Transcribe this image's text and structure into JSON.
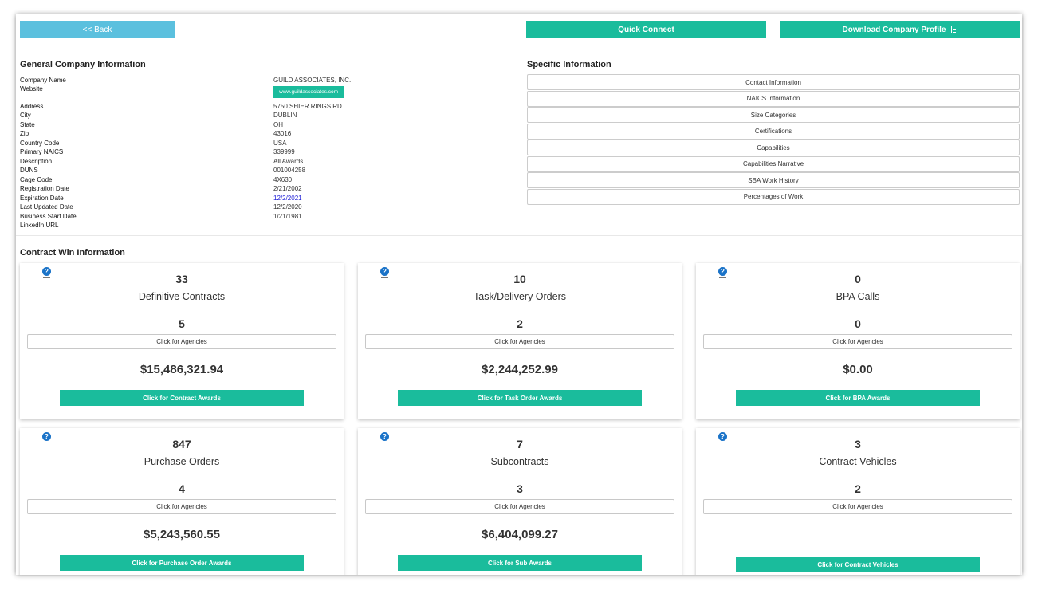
{
  "toolbar": {
    "back_label": "<< Back",
    "quick_connect_label": "Quick Connect",
    "download_label": "Download Company Profile"
  },
  "general": {
    "title": "General Company Information",
    "rows": [
      {
        "label": "Company Name",
        "value": "GUILD ASSOCIATES, INC."
      },
      {
        "label": "Website",
        "value": "www.guildassociates.com"
      },
      {
        "label": "Address",
        "value": "5750 SHIER RINGS RD"
      },
      {
        "label": "City",
        "value": "DUBLIN"
      },
      {
        "label": "State",
        "value": "OH"
      },
      {
        "label": "Zip",
        "value": "43016"
      },
      {
        "label": "Country Code",
        "value": "USA"
      },
      {
        "label": "Primary NAICS",
        "value": "339999"
      },
      {
        "label": "Description",
        "value": "All Awards"
      },
      {
        "label": "DUNS",
        "value": "001004258"
      },
      {
        "label": "Cage Code",
        "value": "4X630"
      },
      {
        "label": "Registration Date",
        "value": "2/21/2002"
      },
      {
        "label": "Expiration Date",
        "value": "12/2/2021"
      },
      {
        "label": "Last Updated Date",
        "value": "12/2/2020"
      },
      {
        "label": "Business Start Date",
        "value": "1/21/1981"
      },
      {
        "label": "LinkedIn URL",
        "value": ""
      }
    ]
  },
  "specific": {
    "title": "Specific Information",
    "items": [
      "Contact Information",
      "NAICS Information",
      "Size Categories",
      "Certifications",
      "Capabilities",
      "Capabilities Narrative",
      "SBA Work History",
      "Percentages of Work"
    ]
  },
  "contracts": {
    "title": "Contract Win Information",
    "agency_label": "Click for Agencies",
    "cards": [
      {
        "count": "33",
        "label": "Definitive Contracts",
        "agencies": "5",
        "amount": "$15,486,321.94",
        "button": "Click for Contract Awards"
      },
      {
        "count": "10",
        "label": "Task/Delivery Orders",
        "agencies": "2",
        "amount": "$2,244,252.99",
        "button": "Click for Task Order Awards"
      },
      {
        "count": "0",
        "label": "BPA Calls",
        "agencies": "0",
        "amount": "$0.00",
        "button": "Click for BPA Awards"
      },
      {
        "count": "847",
        "label": "Purchase Orders",
        "agencies": "4",
        "amount": "$5,243,560.55",
        "button": "Click for Purchase Order Awards"
      },
      {
        "count": "7",
        "label": "Subcontracts",
        "agencies": "3",
        "amount": "$6,404,099.27",
        "button": "Click for Sub Awards"
      },
      {
        "count": "3",
        "label": "Contract Vehicles",
        "agencies": "2",
        "amount": "",
        "button": "Click for Contract Vehicles"
      }
    ]
  },
  "colors": {
    "primary": "#1abc9c",
    "info": "#5bc0de",
    "help": "#1a73c8",
    "link": "#1a1ad6"
  },
  "icons": {
    "download": "document-icon",
    "help": "question-circle-icon"
  }
}
